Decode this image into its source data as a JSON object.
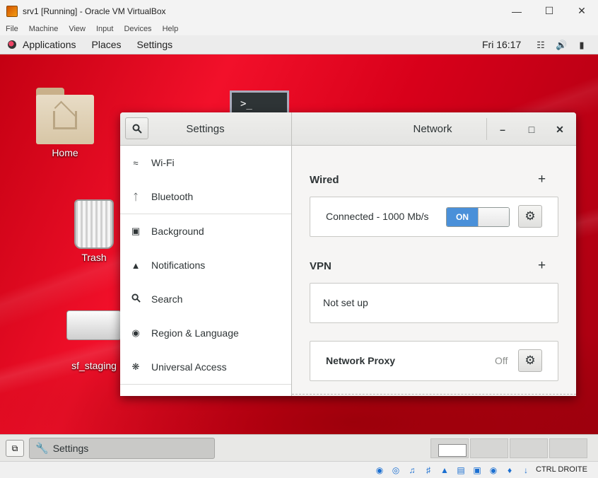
{
  "vbox": {
    "title": "srv1 [Running] - Oracle VM VirtualBox",
    "menus": [
      "File",
      "Machine",
      "View",
      "Input",
      "Devices",
      "Help"
    ],
    "host_key": "CTRL DROITE"
  },
  "gnome_topbar": {
    "menus": [
      "Applications",
      "Places",
      "Settings"
    ],
    "clock": "Fri 16:17"
  },
  "desktop": {
    "icons": [
      "Home",
      "Trash",
      "sf_staging"
    ]
  },
  "settings": {
    "left_title": "Settings",
    "right_title": "Network",
    "sidebar": [
      {
        "label": "Wi-Fi",
        "icon": "wifi-icon"
      },
      {
        "label": "Bluetooth",
        "icon": "bluetooth-icon"
      },
      {
        "label": "Background",
        "icon": "background-icon"
      },
      {
        "label": "Notifications",
        "icon": "bell-icon"
      },
      {
        "label": "Search",
        "icon": "search-icon"
      },
      {
        "label": "Region & Language",
        "icon": "camera-icon"
      },
      {
        "label": "Universal Access",
        "icon": "accessibility-icon"
      }
    ],
    "wired": {
      "title": "Wired",
      "status": "Connected - 1000 Mb/s",
      "toggle": "ON"
    },
    "vpn": {
      "title": "VPN",
      "status": "Not set up"
    },
    "proxy": {
      "title": "Network Proxy",
      "value": "Off"
    }
  },
  "taskbar": {
    "window_label": "Settings"
  }
}
